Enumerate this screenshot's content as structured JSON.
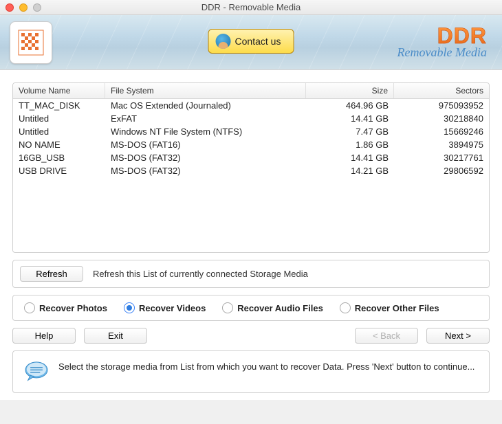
{
  "window": {
    "title": "DDR - Removable Media"
  },
  "header": {
    "contact_label": "Contact us",
    "brand_title": "DDR",
    "brand_subtitle": "Removable Media"
  },
  "table": {
    "headers": {
      "volume": "Volume Name",
      "fs": "File System",
      "size": "Size",
      "sectors": "Sectors"
    },
    "rows": [
      {
        "volume": "TT_MAC_DISK",
        "fs": "Mac OS Extended (Journaled)",
        "size": "464.96  GB",
        "sectors": "975093952"
      },
      {
        "volume": "Untitled",
        "fs": "ExFAT",
        "size": "14.41  GB",
        "sectors": "30218840"
      },
      {
        "volume": "Untitled",
        "fs": "Windows NT File System (NTFS)",
        "size": "7.47  GB",
        "sectors": "15669246"
      },
      {
        "volume": "NO NAME",
        "fs": "MS-DOS (FAT16)",
        "size": "1.86  GB",
        "sectors": "3894975"
      },
      {
        "volume": "16GB_USB",
        "fs": "MS-DOS (FAT32)",
        "size": "14.41  GB",
        "sectors": "30217761"
      },
      {
        "volume": "USB DRIVE",
        "fs": "MS-DOS (FAT32)",
        "size": "14.21  GB",
        "sectors": "29806592"
      }
    ]
  },
  "refresh": {
    "button": "Refresh",
    "hint": "Refresh this List of currently connected Storage Media"
  },
  "recover": {
    "options": [
      "Recover Photos",
      "Recover Videos",
      "Recover Audio Files",
      "Recover Other Files"
    ],
    "selected": 1
  },
  "nav": {
    "help": "Help",
    "exit": "Exit",
    "back": "< Back",
    "next": "Next >"
  },
  "hint": {
    "text": "Select the storage media from List from which you want to recover Data. Press 'Next' button to continue..."
  }
}
